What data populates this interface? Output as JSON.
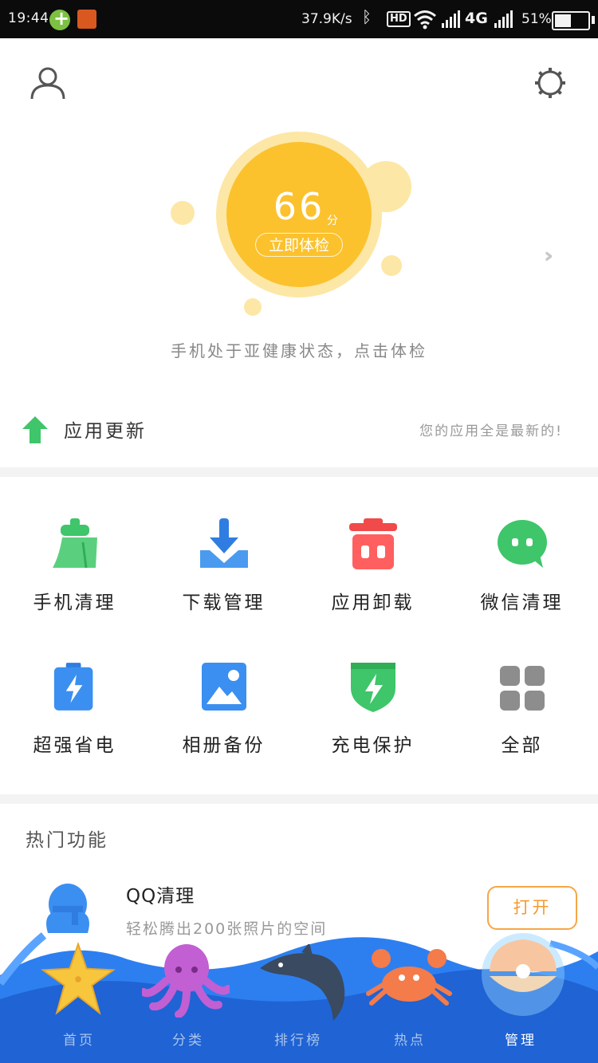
{
  "status_bar": {
    "time": "19:44",
    "speed": "37.9K/s",
    "hd": "HD",
    "network": "4G",
    "battery_pct": "51%",
    "battery_level": 0.51
  },
  "header": {
    "profile_icon": "user-icon",
    "settings_icon": "gear-icon"
  },
  "score": {
    "value": "66",
    "unit": "分",
    "check_button": "立即体检",
    "status_text": "手机处于亚健康状态，点击体检",
    "more_icon": "double-chevron-right-icon"
  },
  "update": {
    "label": "应用更新",
    "status": "您的应用全是最新的!",
    "icon": "up-arrow-icon"
  },
  "tools": [
    {
      "label": "手机清理",
      "icon": "broom-icon"
    },
    {
      "label": "下载管理",
      "icon": "download-icon"
    },
    {
      "label": "应用卸载",
      "icon": "trash-icon"
    },
    {
      "label": "微信清理",
      "icon": "wechat-icon"
    },
    {
      "label": "超强省电",
      "icon": "battery-bolt-icon"
    },
    {
      "label": "相册备份",
      "icon": "photo-icon"
    },
    {
      "label": "充电保护",
      "icon": "shield-bolt-icon"
    },
    {
      "label": "全部",
      "icon": "grid-icon"
    }
  ],
  "hot": {
    "section_title": "热门功能",
    "item_title": "QQ清理",
    "item_subtitle": "轻松腾出200张照片的空间",
    "open_button": "打开",
    "item_icon": "qq-penguin-icon"
  },
  "bottom_nav": [
    {
      "label": "首页",
      "icon": "starfish-icon"
    },
    {
      "label": "分类",
      "icon": "octopus-icon"
    },
    {
      "label": "排行榜",
      "icon": "dolphin-icon"
    },
    {
      "label": "热点",
      "icon": "crab-icon"
    },
    {
      "label": "管理",
      "icon": "shell-icon",
      "active": true
    }
  ],
  "colors": {
    "accent_yellow": "#fbc22e",
    "accent_orange": "#f59a2e",
    "nav_blue": "#1f63d4",
    "green": "#3fc56a"
  }
}
